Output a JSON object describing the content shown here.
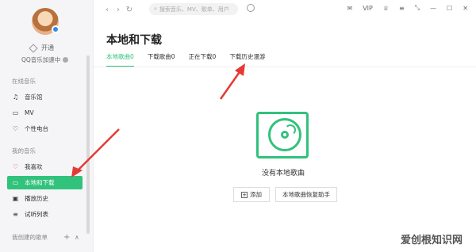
{
  "sidebar": {
    "vip_label": "开通",
    "accel_label": "QQ音乐加速中",
    "online_section": "在线音乐",
    "online_items": [
      "音乐馆",
      "MV",
      "个性电台"
    ],
    "my_section": "我的音乐",
    "my_items": [
      "我喜欢",
      "本地和下载",
      "播放历史",
      "试听列表"
    ],
    "created_section": "我创建的歌单"
  },
  "topbar": {
    "search_placeholder": "搜索音乐、MV、歌单、用户",
    "vip_text": "VIP"
  },
  "main": {
    "title": "本地和下载",
    "tabs": [
      "本地歌曲0",
      "下载歌曲0",
      "正在下载0",
      "下载历史漫游"
    ],
    "empty_text": "没有本地歌曲",
    "add_button": "添加",
    "restore_button": "本地歌曲恢复助手"
  },
  "watermark": "爱创根知识网",
  "colors": {
    "accent": "#31c27c",
    "annotation": "#e53935"
  }
}
